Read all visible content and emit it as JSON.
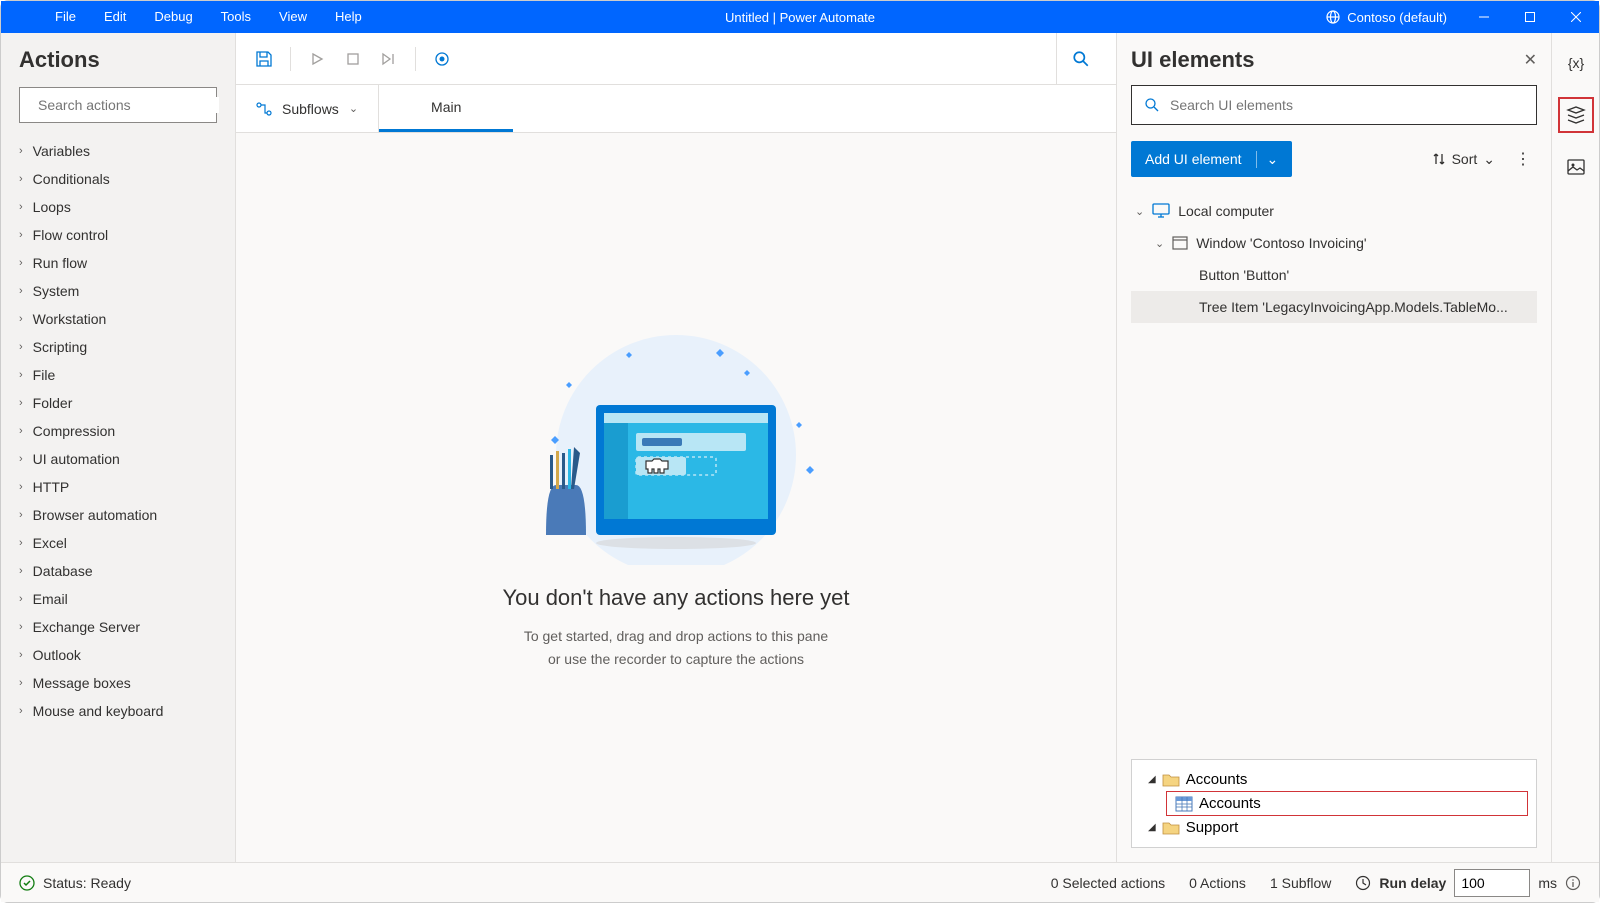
{
  "titlebar": {
    "menus": [
      "File",
      "Edit",
      "Debug",
      "Tools",
      "View",
      "Help"
    ],
    "title": "Untitled | Power Automate",
    "environment": "Contoso (default)"
  },
  "actions_panel": {
    "title": "Actions",
    "search_placeholder": "Search actions",
    "categories": [
      "Variables",
      "Conditionals",
      "Loops",
      "Flow control",
      "Run flow",
      "System",
      "Workstation",
      "Scripting",
      "File",
      "Folder",
      "Compression",
      "UI automation",
      "HTTP",
      "Browser automation",
      "Excel",
      "Database",
      "Email",
      "Exchange Server",
      "Outlook",
      "Message boxes",
      "Mouse and keyboard"
    ]
  },
  "tabs": {
    "subflows_label": "Subflows",
    "main_tab": "Main"
  },
  "canvas": {
    "empty_title": "You don't have any actions here yet",
    "empty_line1": "To get started, drag and drop actions to this pane",
    "empty_line2": "or use the recorder to capture the actions"
  },
  "ui_panel": {
    "title": "UI elements",
    "search_placeholder": "Search UI elements",
    "add_button": "Add UI element",
    "sort_label": "Sort",
    "tree": {
      "root": "Local computer",
      "window": "Window 'Contoso Invoicing'",
      "button": "Button 'Button'",
      "treeitem": "Tree Item 'LegacyInvoicingApp.Models.TableMo..."
    },
    "preview": {
      "item1": "Accounts",
      "item2": "Accounts",
      "item3": "Support"
    }
  },
  "status": {
    "ready": "Status: Ready",
    "selected": "0 Selected actions",
    "actions": "0 Actions",
    "subflow": "1 Subflow",
    "delay_label": "Run delay",
    "delay_value": "100",
    "delay_unit": "ms"
  }
}
